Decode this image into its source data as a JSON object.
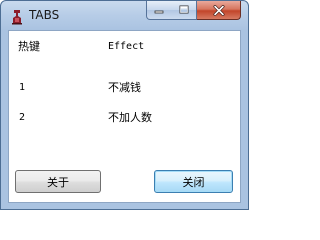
{
  "window": {
    "title": "TABS",
    "icon": "app-icon"
  },
  "titlebar_buttons": {
    "minimize_icon": "minimize-icon",
    "maximize_icon": "maximize-icon",
    "close_icon": "close-icon"
  },
  "table": {
    "headers": {
      "key": "热键",
      "effect": "Effect"
    },
    "rows": [
      {
        "key": "1",
        "effect": "不减钱"
      },
      {
        "key": "2",
        "effect": "不加人数"
      }
    ]
  },
  "buttons": {
    "about_label": "关于",
    "close_label": "关闭"
  },
  "colors": {
    "titlebar": "#b7cde7",
    "close_button": "#c2452a",
    "default_button_border": "#3c7fb1"
  }
}
